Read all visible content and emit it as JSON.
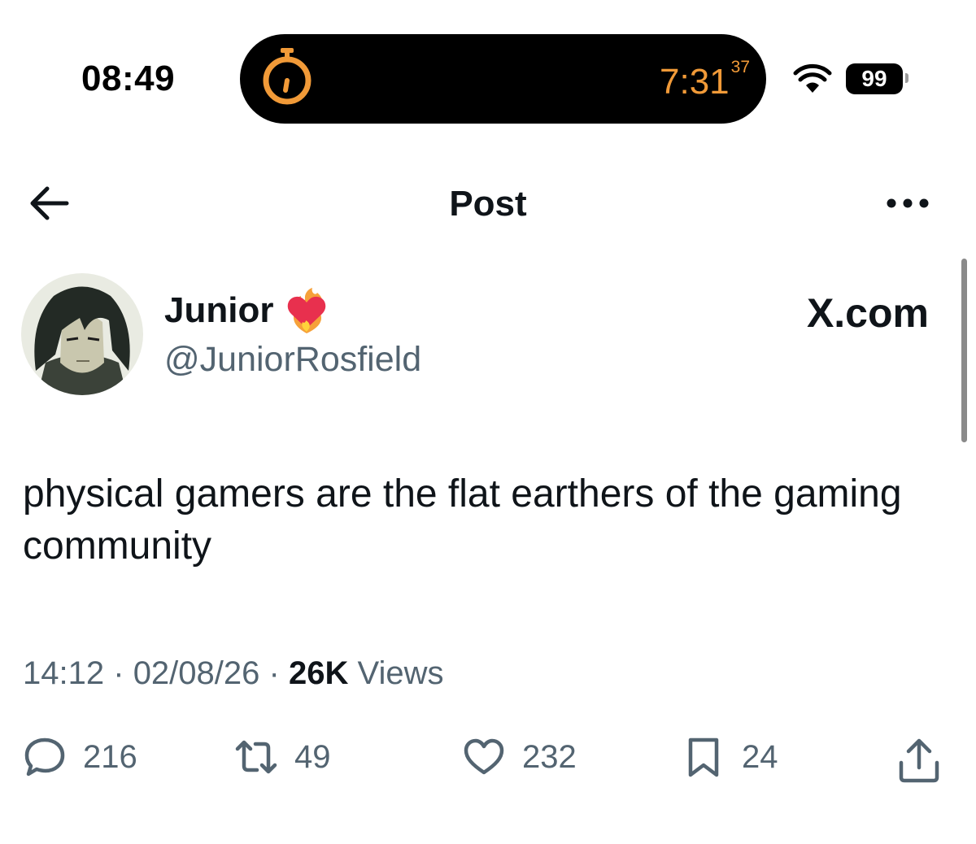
{
  "status_bar": {
    "time": "08:49",
    "timer_main": "7:31",
    "timer_seconds": "37",
    "battery": "99",
    "timer_color": "#f19a38"
  },
  "header": {
    "title": "Post",
    "back_icon": "arrow-left-icon",
    "more_icon": "more-dots-icon"
  },
  "author": {
    "name": "Junior",
    "handle": "@JuniorRosfield",
    "name_emoji": "heart-on-fire-emoji"
  },
  "source_label": "X.com",
  "post": {
    "text": "physical gamers are the flat earthers of the gaming community",
    "time": "14:12",
    "date": "02/08/26",
    "views_count": "26K",
    "views_label": "Views",
    "separator": "·"
  },
  "actions": {
    "replies": "216",
    "reposts": "49",
    "likes": "232",
    "bookmarks": "24"
  },
  "colors": {
    "text": "#0f1419",
    "secondary": "#536471"
  }
}
